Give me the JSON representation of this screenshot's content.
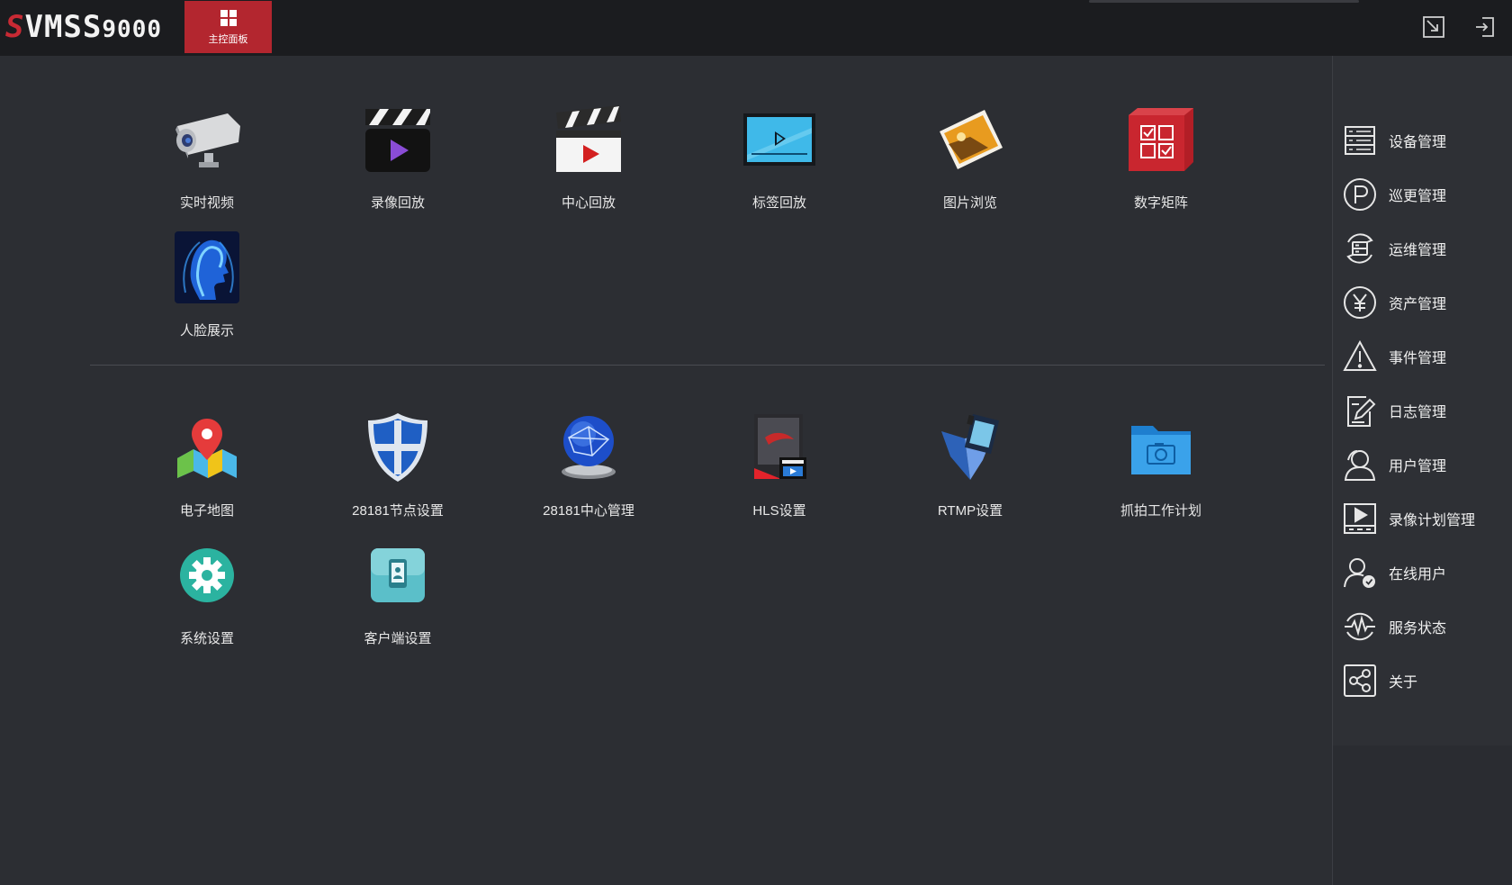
{
  "app": {
    "logo_prefix": "S",
    "logo_main": "VMS",
    "logo_s": "S",
    "logo_suffix": "9000",
    "home_tab_label": "主控面板"
  },
  "top_icons": [
    "restore-window-icon",
    "logout-icon"
  ],
  "section1": [
    {
      "label": "实时视频",
      "icon": "camera-icon"
    },
    {
      "label": "录像回放",
      "icon": "clapper-play-icon"
    },
    {
      "label": "中心回放",
      "icon": "clapper-center-icon"
    },
    {
      "label": "标签回放",
      "icon": "tag-playback-icon"
    },
    {
      "label": "图片浏览",
      "icon": "picture-icon"
    },
    {
      "label": "数字矩阵",
      "icon": "matrix-icon"
    },
    {
      "label": "人脸展示",
      "icon": "face-icon"
    }
  ],
  "section2": [
    {
      "label": "电子地图",
      "icon": "map-icon"
    },
    {
      "label": "28181节点设置",
      "icon": "shield-icon"
    },
    {
      "label": "28181中心管理",
      "icon": "globe-icon"
    },
    {
      "label": "HLS设置",
      "icon": "hls-icon"
    },
    {
      "label": "RTMP设置",
      "icon": "rtmp-icon"
    },
    {
      "label": "抓拍工作计划",
      "icon": "snapshot-folder-icon"
    },
    {
      "label": "系统设置",
      "icon": "settings-gear-icon"
    },
    {
      "label": "客户端设置",
      "icon": "client-icon"
    }
  ],
  "sidebar": [
    {
      "label": "设备管理",
      "icon": "server-list-icon"
    },
    {
      "label": "巡更管理",
      "icon": "patrol-p-icon"
    },
    {
      "label": "运维管理",
      "icon": "maintenance-icon"
    },
    {
      "label": "资产管理",
      "icon": "yen-icon"
    },
    {
      "label": "事件管理",
      "icon": "warning-icon"
    },
    {
      "label": "日志管理",
      "icon": "log-edit-icon"
    },
    {
      "label": "用户管理",
      "icon": "users-icon"
    },
    {
      "label": "录像计划管理",
      "icon": "record-plan-icon"
    },
    {
      "label": "在线用户",
      "icon": "online-user-icon"
    },
    {
      "label": "服务状态",
      "icon": "service-status-icon"
    },
    {
      "label": "关于",
      "icon": "share-icon"
    }
  ],
  "colors": {
    "accent": "#b3262f",
    "background": "#2c2e33",
    "topbar": "#1b1c1f"
  }
}
